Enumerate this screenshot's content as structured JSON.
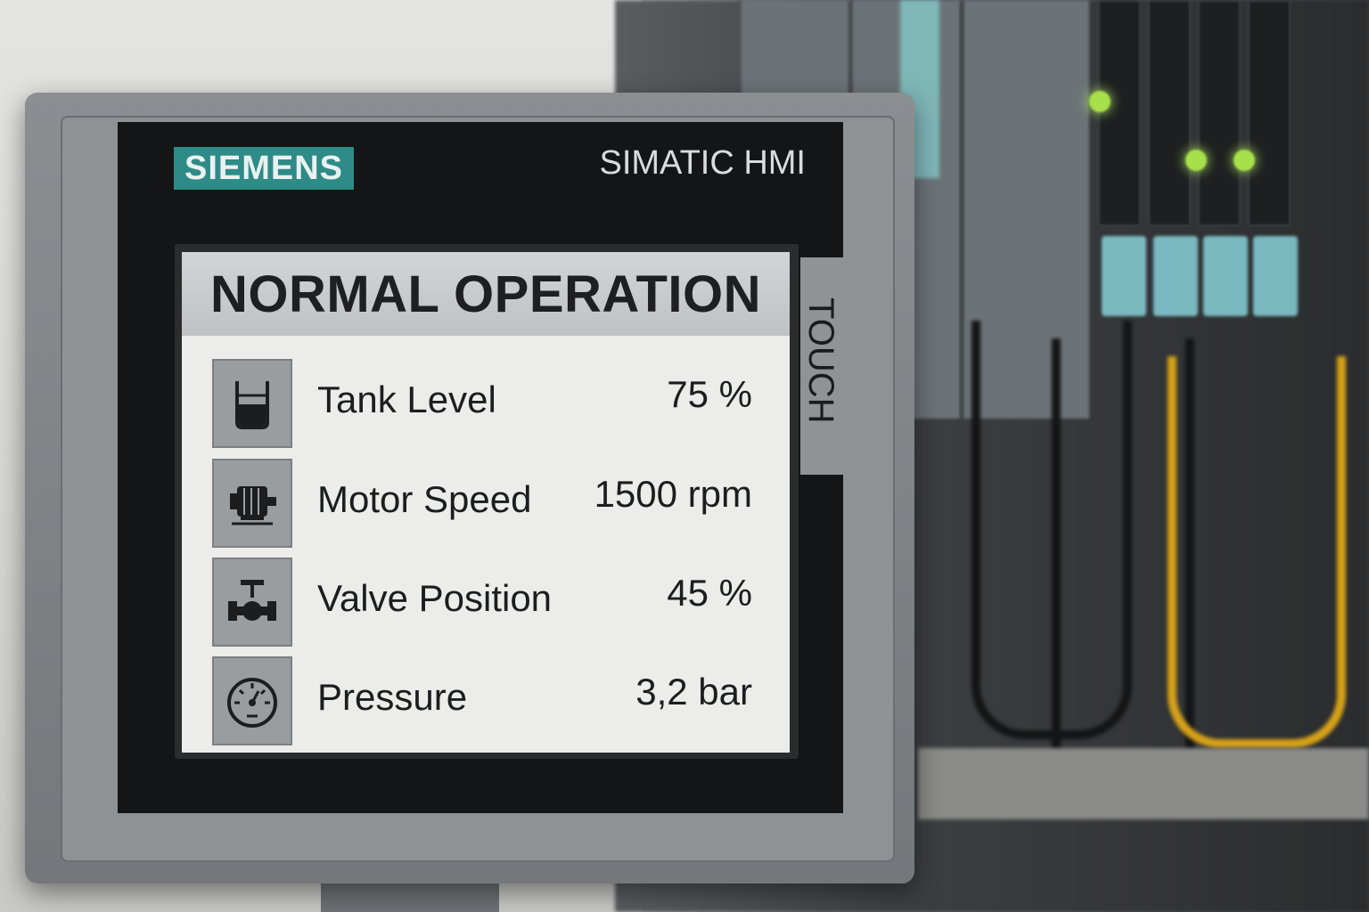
{
  "device": {
    "brand": "SIEMENS",
    "model_label": "SIMATIC HMI",
    "side_label": "TOUCH",
    "colors": {
      "brand": "#2e8b87",
      "display_bg": "#ececea",
      "header_bg": "#c7c9cc"
    }
  },
  "screen": {
    "status": "NORMAL OPERATION",
    "rows": [
      {
        "icon": "tank-icon",
        "label": "Tank Level",
        "value": "75 %"
      },
      {
        "icon": "motor-icon",
        "label": "Motor Speed",
        "value": "1500 rpm"
      },
      {
        "icon": "valve-icon",
        "label": "Valve Position",
        "value": "45 %"
      },
      {
        "icon": "pressure-gauge-icon",
        "label": "Pressure",
        "value": "3,2 bar"
      }
    ]
  }
}
